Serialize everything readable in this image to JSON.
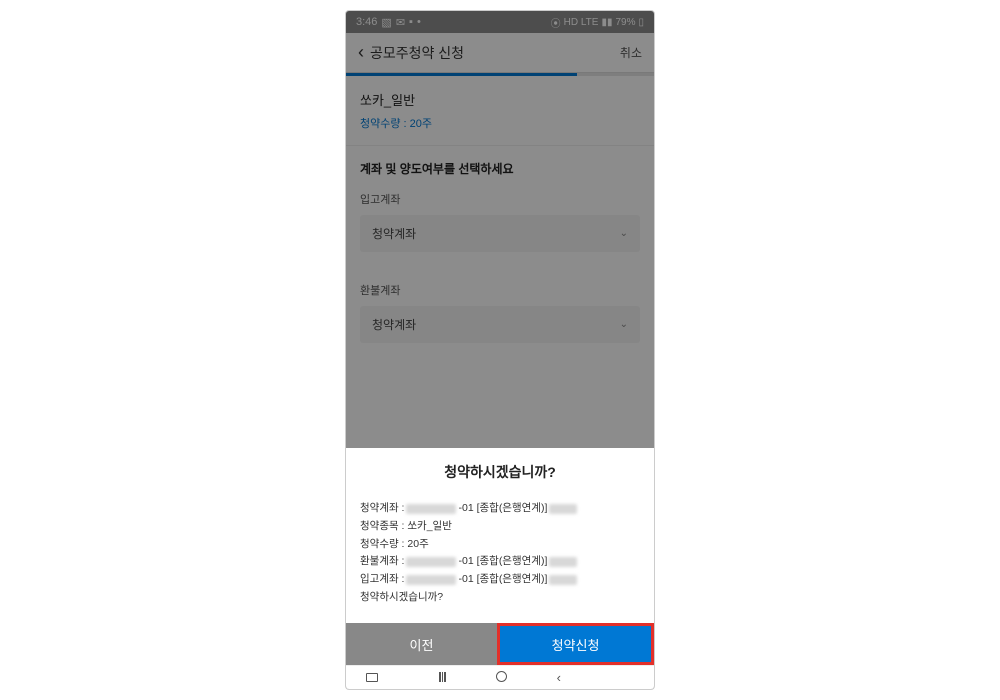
{
  "statusBar": {
    "time": "3:46",
    "network": "HD LTE",
    "battery": "79%"
  },
  "header": {
    "title": "공모주청약 신청",
    "cancel": "취소"
  },
  "info": {
    "stockName": "쏘카_일반",
    "quantity": "청약수량 : 20주"
  },
  "selectSection": {
    "title": "계좌 및 양도여부를 선택하세요",
    "depositLabel": "입고계좌",
    "depositValue": "청약계좌",
    "refundLabel": "환불계좌",
    "refundValue": "청약계좌"
  },
  "modal": {
    "title": "청약하시겠습니까?",
    "row1Label": "청약계좌 :",
    "row1Suffix": "-01 [종합(은행연계)]",
    "row2": "청약종목 : 쏘카_일반",
    "row3": "청약수량 : 20주",
    "row4Label": "환불계좌 :",
    "row4Suffix": "-01 [종합(은행연계)]",
    "row5Label": "입고계좌 :",
    "row5Suffix": "-01 [종합(은행연계)]",
    "row6": "청약하시겠습니까?",
    "btnPrev": "이전",
    "btnSubmit": "청약신청"
  }
}
